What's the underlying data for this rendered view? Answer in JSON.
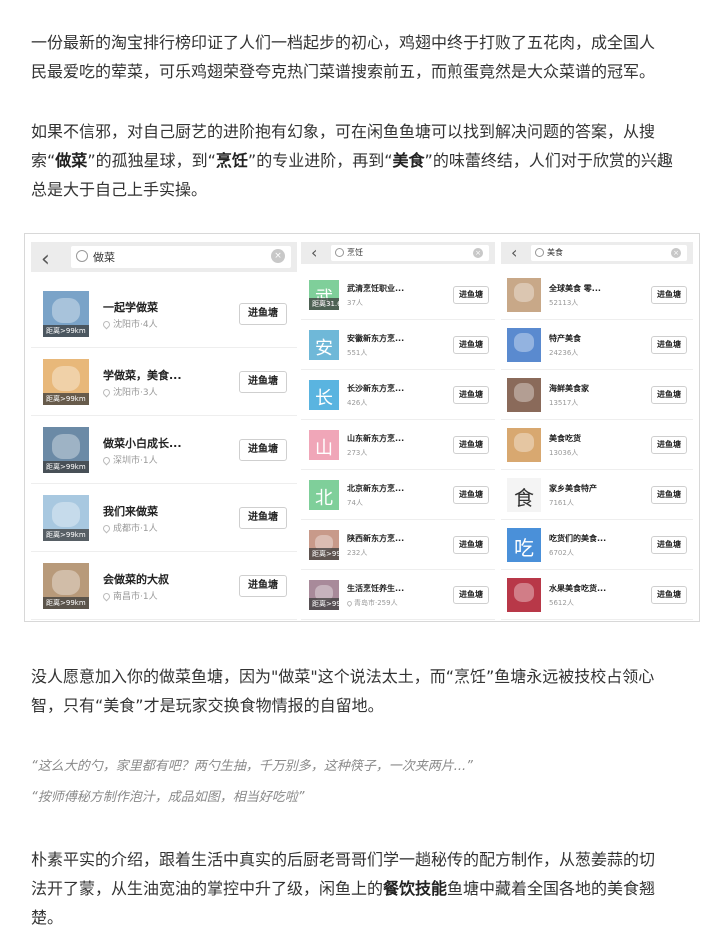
{
  "paragraphs": {
    "p1_l1": "一份最新的淘宝排行榜印证了人们一档起步的初心，鸡翅中终于打败了五花肉，成全国人",
    "p1_l2": "民最爱吃的荤菜，可乐鸡翅荣登夸克热门菜谱搜索前五，而煎蛋竟然是大众菜谱的冠军。",
    "p2_l1": "如果不信邪，对自己厨艺的进阶抱有幻象，可在闲鱼鱼塘可以找到解决问题的答案，从搜",
    "p2_l2a": "索“",
    "p2_l2b": "做菜",
    "p2_l2c": "”的孤独星球，到“",
    "p2_l2d": "烹饪",
    "p2_l2e": "”的专业进阶，再到“",
    "p2_l2f": "美食",
    "p2_l2g": "”的味蕾终结，人们对于欣赏的兴趣",
    "p2_l3": "总是大于自己上手实操。",
    "p3_l1": "没人愿意加入你的做菜鱼塘，因为\"做菜\"这个说法太土，而“烹饪”鱼塘永远被技校占领心",
    "p3_l2": "智，只有“美食”才是玩家交换食物情报的自留地。",
    "q1": "“这么大的勺，家里都有吧？两勺生抽，千万别多，这种筷子，一次夹两片...”",
    "q2": "“按师傅秘方制作泡汁，成品如图，相当好吃啦”",
    "p4_l1": "朴素平实的介绍，跟着生活中真实的后厨老哥哥们学一趟秘传的配方制作，从葱姜蒜的切",
    "p4_l2": "法开了蒙，从生油宽油的掌控中升了级，闲鱼上的",
    "p4_l2b": "餐饮技能",
    "p4_l2c": "鱼塘中藏着全国各地的美食翘",
    "p4_l3": "楚。"
  },
  "panels": [
    {
      "keyword": "做菜",
      "button": "进鱼塘",
      "items": [
        {
          "name": "一起学做菜",
          "meta": "沈阳市·4人",
          "dist": "距离>99km",
          "color": "#7aa3c8"
        },
        {
          "name": "学做菜，美食...",
          "meta": "沈阳市·3人",
          "dist": "距离>99km",
          "color": "#e8b87a"
        },
        {
          "name": "做菜小白成长...",
          "meta": "深圳市·1人",
          "dist": "距离>99km",
          "color": "#6b8aa6"
        },
        {
          "name": "我们来做菜",
          "meta": "成都市·1人",
          "dist": "距离>99km",
          "color": "#a8c8e0"
        },
        {
          "name": "会做菜的大叔",
          "meta": "南昌市·1人",
          "dist": "距离>99km",
          "color": "#b89a7a"
        }
      ]
    },
    {
      "keyword": "烹饪",
      "button": "进鱼塘",
      "items": [
        {
          "name": "武清烹饪职业...",
          "meta": "37人",
          "dist": "距离31.6km",
          "glyph": "武",
          "color": "#7fcf9a"
        },
        {
          "name": "安徽新东方烹...",
          "meta": "551人",
          "dist": "",
          "glyph": "安",
          "color": "#6fb8d8"
        },
        {
          "name": "长沙新东方烹...",
          "meta": "426人",
          "dist": "",
          "glyph": "长",
          "color": "#5ab4e0"
        },
        {
          "name": "山东新东方烹...",
          "meta": "273人",
          "dist": "",
          "glyph": "山",
          "color": "#f0a6b8"
        },
        {
          "name": "北京新东方烹...",
          "meta": "74人",
          "dist": "",
          "glyph": "北",
          "color": "#7fcf9a"
        },
        {
          "name": "陕西新东方烹...",
          "meta": "232人",
          "dist": "距离>99km",
          "glyph": "",
          "color": "#c89a8a"
        },
        {
          "name": "生活烹饪养生...",
          "meta": "青岛市·259人",
          "dist": "距离>99km",
          "glyph": "",
          "color": "#a88a9a"
        }
      ]
    },
    {
      "keyword": "美食",
      "button": "进鱼塘",
      "items": [
        {
          "name": "全球美食 零...",
          "meta": "52113人",
          "color": "#c8a888",
          "glyph": ""
        },
        {
          "name": "特产美食",
          "meta": "24236人",
          "color": "#5a8acf",
          "glyph": ""
        },
        {
          "name": "海鲜美食家",
          "meta": "13517人",
          "color": "#8a6a5a",
          "glyph": ""
        },
        {
          "name": "美食吃货",
          "meta": "13036人",
          "color": "#d8a870",
          "glyph": ""
        },
        {
          "name": "家乡美食特产",
          "meta": "7161人",
          "color": "#f4f4f4",
          "glyph": "食"
        },
        {
          "name": "吃货们的美食...",
          "meta": "6702人",
          "color": "#4a90d9",
          "glyph": "吃"
        },
        {
          "name": "水果美食吃货...",
          "meta": "5612人",
          "color": "#b83848",
          "glyph": ""
        }
      ]
    }
  ]
}
